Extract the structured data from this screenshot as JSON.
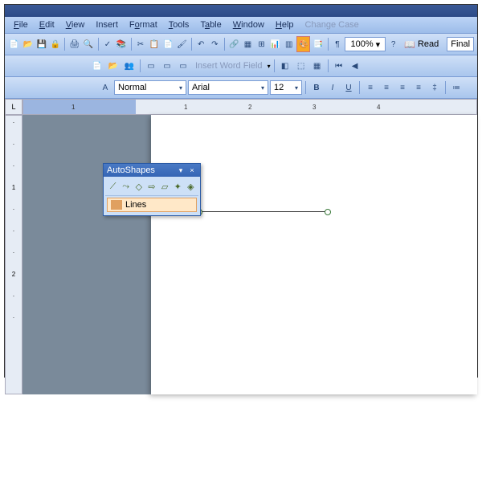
{
  "menu": {
    "file": "File",
    "edit": "Edit",
    "view": "View",
    "insert": "Insert",
    "format": "Format",
    "tools": "Tools",
    "table": "Table",
    "window": "Window",
    "help": "Help",
    "change_case": "Change Case"
  },
  "toolbar": {
    "insert_field": "Insert Word Field",
    "zoom": "100%",
    "read": "Read",
    "final": "Final"
  },
  "format": {
    "style": "Normal",
    "font": "Arial",
    "size": "12"
  },
  "ruler": {
    "corner": "L",
    "marks": [
      "1",
      "1",
      "2",
      "3",
      "4"
    ]
  },
  "autoshapes": {
    "title": "AutoShapes",
    "lines": "Lines"
  }
}
